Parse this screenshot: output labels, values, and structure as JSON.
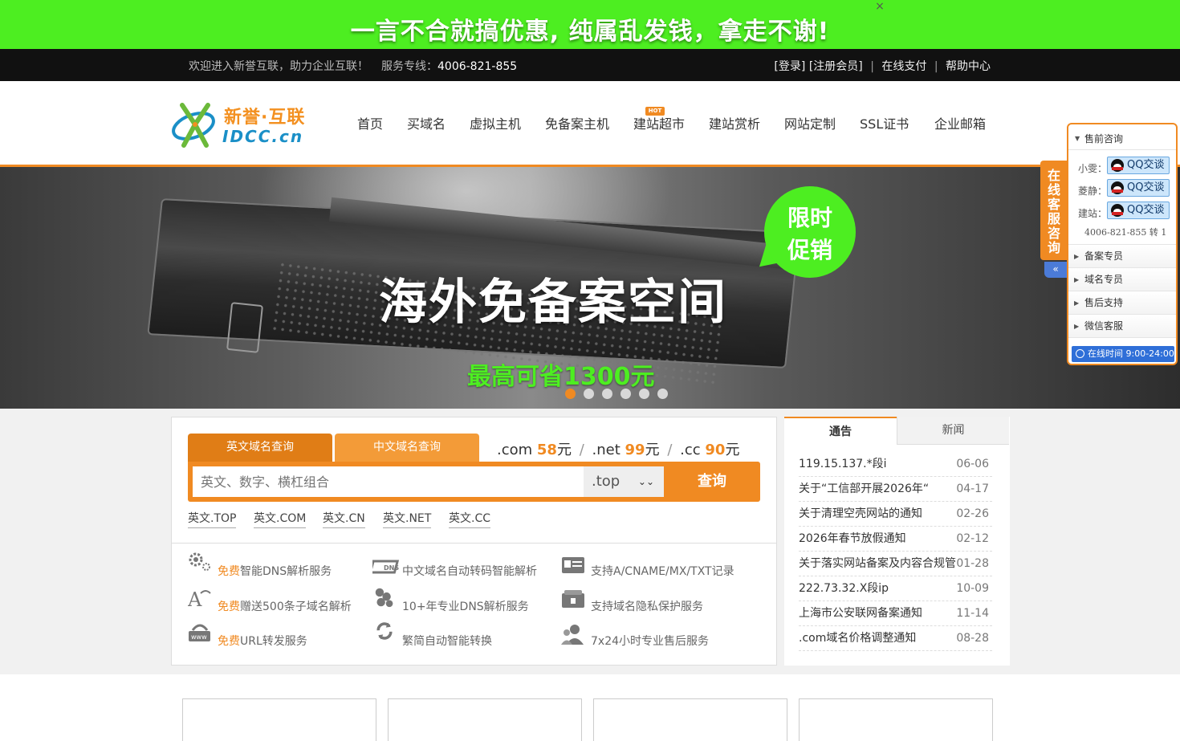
{
  "promo": {
    "text": "一言不合就搞优惠, 纯属乱发钱，拿走不谢!",
    "close": "×"
  },
  "topbar": {
    "welcome": "欢迎进入新誉互联，助力企业互联！",
    "hotline_label": "服务专线：",
    "hotline": "4006-821-855",
    "login": "[登录]",
    "register": "[注册会员]",
    "pay": "在线支付",
    "help": "帮助中心",
    "sep": "|"
  },
  "logo": {
    "cn": "新誉·互联",
    "en": "IDCC.cn"
  },
  "nav": {
    "items": [
      "首页",
      "买域名",
      "虚拟主机",
      "免备案主机",
      "建站超市",
      "建站赏析",
      "网站定制",
      "SSL证书",
      "企业邮箱"
    ],
    "hot_badge": "HOT"
  },
  "banner": {
    "title": "海外免备案空间",
    "subtitle": "最高可省1300元",
    "bubble_line1": "限时",
    "bubble_line2": "促销",
    "slide_count": 6,
    "active_slide": 1
  },
  "domain": {
    "tab_en": "英文域名查询",
    "tab_cn": "中文域名查询",
    "prices": [
      {
        "ext": ".com",
        "price": "58",
        "unit": "元"
      },
      {
        "ext": ".net",
        "price": "99",
        "unit": "元"
      },
      {
        "ext": ".cc",
        "price": "90",
        "unit": "元"
      }
    ],
    "price_sep": "/",
    "search_placeholder": "英文、数字、横杠组合",
    "suffix": ".top",
    "search_button": "查询",
    "quick_links": [
      "英文.TOP",
      "英文.COM",
      "英文.CN",
      "英文.NET",
      "英文.CC"
    ]
  },
  "features": [
    {
      "free": "免费",
      "text": "智能DNS解析服务",
      "icon": "gear-dns-icon"
    },
    {
      "free": "",
      "text": "中文域名自动转码智能解析",
      "icon": "dns-transcode-icon"
    },
    {
      "free": "",
      "text": "支持A/CNAME/MX/TXT记录",
      "icon": "record-card-icon"
    },
    {
      "free": "免费",
      "text": "赠送500条子域名解析",
      "icon": "subdomain-icon"
    },
    {
      "free": "",
      "text": "10+年专业DNS解析服务",
      "icon": "server-cluster-icon"
    },
    {
      "free": "",
      "text": "支持域名隐私保护服务",
      "icon": "privacy-lock-icon"
    },
    {
      "free": "免费",
      "text": "URL转发服务",
      "icon": "www-forward-icon"
    },
    {
      "free": "",
      "text": "繁简自动智能转换",
      "icon": "convert-icon"
    },
    {
      "free": "",
      "text": "7x24小时专业售后服务",
      "icon": "support-people-icon"
    }
  ],
  "news": {
    "tab_notice": "通告",
    "tab_news": "新闻",
    "items": [
      {
        "title": "119.15.137.*段i",
        "date": "06-06"
      },
      {
        "title": "关于“工信部开展2026年“",
        "date": "04-17"
      },
      {
        "title": "关于清理空壳网站的通知",
        "date": "02-26"
      },
      {
        "title": "2026年春节放假通知",
        "date": "02-12"
      },
      {
        "title": "关于落实网站备案及内容合规管",
        "date": "01-28"
      },
      {
        "title": "222.73.32.X段ip",
        "date": "10-09"
      },
      {
        "title": "上海市公安联网备案通知",
        "date": "11-14"
      },
      {
        "title": ".com域名价格调整通知",
        "date": "08-28"
      }
    ]
  },
  "cs": {
    "side_tab": "在线客服咨询",
    "collapse": "«",
    "presale": "售前咨询",
    "agents": [
      {
        "name": "小雯：",
        "button": "QQ交谈"
      },
      {
        "name": "菱静：",
        "button": "QQ交谈"
      },
      {
        "name": "建站：",
        "button": "QQ交谈"
      }
    ],
    "phone": "4006-821-855 转 1",
    "sections": [
      "备案专员",
      "域名专员",
      "售后支持",
      "微信客服"
    ],
    "hours": "在线时间 9:00-24:00"
  },
  "colors": {
    "accent": "#f08a22",
    "promo_green": "#4dee21",
    "topbar": "#111111"
  }
}
